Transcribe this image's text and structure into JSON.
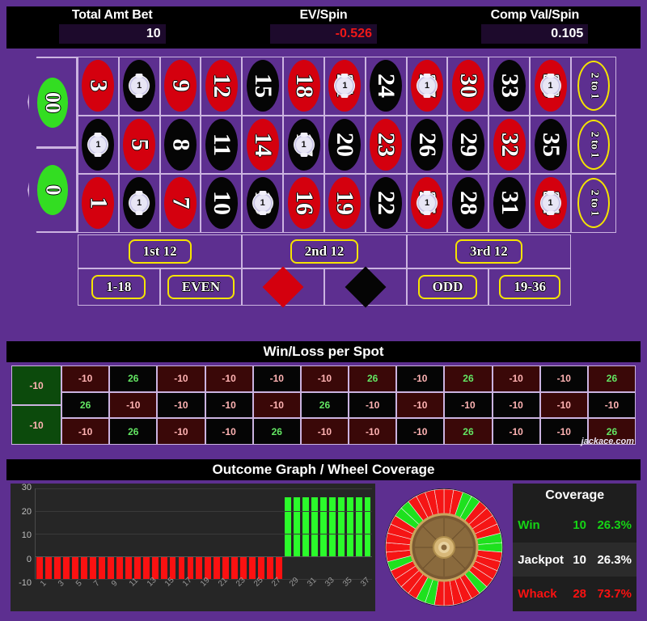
{
  "stats": [
    {
      "label": "Total Amt Bet",
      "value": "10",
      "negative": false
    },
    {
      "label": "EV/Spin",
      "value": "-0.526",
      "negative": true
    },
    {
      "label": "Comp Val/Spin",
      "value": "0.105",
      "negative": false
    }
  ],
  "table": {
    "zeros": [
      {
        "label": "00",
        "color": "green",
        "chip": null
      },
      {
        "label": "0",
        "color": "green",
        "chip": null
      }
    ],
    "rows": [
      [
        {
          "n": "3",
          "color": "red",
          "chip": null
        },
        {
          "n": "6",
          "color": "black",
          "chip": "1"
        },
        {
          "n": "9",
          "color": "red",
          "chip": null
        },
        {
          "n": "12",
          "color": "red",
          "chip": null
        },
        {
          "n": "15",
          "color": "black",
          "chip": null
        },
        {
          "n": "18",
          "color": "red",
          "chip": null
        },
        {
          "n": "21",
          "color": "red",
          "chip": "1"
        },
        {
          "n": "24",
          "color": "black",
          "chip": null
        },
        {
          "n": "27",
          "color": "red",
          "chip": "1"
        },
        {
          "n": "30",
          "color": "red",
          "chip": null
        },
        {
          "n": "33",
          "color": "black",
          "chip": null
        },
        {
          "n": "36",
          "color": "red",
          "chip": "1"
        }
      ],
      [
        {
          "n": "2",
          "color": "black",
          "chip": "1"
        },
        {
          "n": "5",
          "color": "red",
          "chip": null
        },
        {
          "n": "8",
          "color": "black",
          "chip": null
        },
        {
          "n": "11",
          "color": "black",
          "chip": null
        },
        {
          "n": "14",
          "color": "red",
          "chip": null
        },
        {
          "n": "17",
          "color": "black",
          "chip": "1"
        },
        {
          "n": "20",
          "color": "black",
          "chip": null
        },
        {
          "n": "23",
          "color": "red",
          "chip": null
        },
        {
          "n": "26",
          "color": "black",
          "chip": null
        },
        {
          "n": "29",
          "color": "black",
          "chip": null
        },
        {
          "n": "32",
          "color": "red",
          "chip": null
        },
        {
          "n": "35",
          "color": "black",
          "chip": null
        }
      ],
      [
        {
          "n": "1",
          "color": "red",
          "chip": null
        },
        {
          "n": "4",
          "color": "black",
          "chip": "1"
        },
        {
          "n": "7",
          "color": "red",
          "chip": null
        },
        {
          "n": "10",
          "color": "black",
          "chip": null
        },
        {
          "n": "13",
          "color": "black",
          "chip": "1"
        },
        {
          "n": "16",
          "color": "red",
          "chip": null
        },
        {
          "n": "19",
          "color": "red",
          "chip": null
        },
        {
          "n": "22",
          "color": "black",
          "chip": null
        },
        {
          "n": "25",
          "color": "red",
          "chip": "1"
        },
        {
          "n": "28",
          "color": "black",
          "chip": null
        },
        {
          "n": "31",
          "color": "black",
          "chip": null
        },
        {
          "n": "34",
          "color": "red",
          "chip": "1"
        }
      ]
    ],
    "column_bets": [
      "2 to 1",
      "2 to 1",
      "2 to 1"
    ],
    "dozens": [
      "1st 12",
      "2nd 12",
      "3rd 12"
    ],
    "outside": [
      {
        "type": "text",
        "label": "1-18"
      },
      {
        "type": "text",
        "label": "EVEN"
      },
      {
        "type": "diamond",
        "color": "red",
        "label": "RED"
      },
      {
        "type": "diamond",
        "color": "black",
        "label": "BLACK"
      },
      {
        "type": "text",
        "label": "ODD"
      },
      {
        "type": "text",
        "label": "19-36"
      }
    ]
  },
  "winloss": {
    "title": "Win/Loss per Spot",
    "zeros": [
      "-10",
      "-10"
    ],
    "rows": [
      [
        {
          "v": "-10",
          "cell": "red",
          "res": "lose"
        },
        {
          "v": "26",
          "cell": "black",
          "res": "win"
        },
        {
          "v": "-10",
          "cell": "red",
          "res": "lose"
        },
        {
          "v": "-10",
          "cell": "red",
          "res": "lose"
        },
        {
          "v": "-10",
          "cell": "black",
          "res": "lose"
        },
        {
          "v": "-10",
          "cell": "red",
          "res": "lose"
        },
        {
          "v": "26",
          "cell": "red",
          "res": "win"
        },
        {
          "v": "-10",
          "cell": "black",
          "res": "lose"
        },
        {
          "v": "26",
          "cell": "red",
          "res": "win"
        },
        {
          "v": "-10",
          "cell": "red",
          "res": "lose"
        },
        {
          "v": "-10",
          "cell": "black",
          "res": "lose"
        },
        {
          "v": "26",
          "cell": "red",
          "res": "win"
        }
      ],
      [
        {
          "v": "26",
          "cell": "black",
          "res": "win"
        },
        {
          "v": "-10",
          "cell": "red",
          "res": "lose"
        },
        {
          "v": "-10",
          "cell": "black",
          "res": "lose"
        },
        {
          "v": "-10",
          "cell": "black",
          "res": "lose"
        },
        {
          "v": "-10",
          "cell": "red",
          "res": "lose"
        },
        {
          "v": "26",
          "cell": "black",
          "res": "win"
        },
        {
          "v": "-10",
          "cell": "black",
          "res": "lose"
        },
        {
          "v": "-10",
          "cell": "red",
          "res": "lose"
        },
        {
          "v": "-10",
          "cell": "black",
          "res": "lose"
        },
        {
          "v": "-10",
          "cell": "black",
          "res": "lose"
        },
        {
          "v": "-10",
          "cell": "red",
          "res": "lose"
        },
        {
          "v": "-10",
          "cell": "black",
          "res": "lose"
        }
      ],
      [
        {
          "v": "-10",
          "cell": "red",
          "res": "lose"
        },
        {
          "v": "26",
          "cell": "black",
          "res": "win"
        },
        {
          "v": "-10",
          "cell": "red",
          "res": "lose"
        },
        {
          "v": "-10",
          "cell": "black",
          "res": "lose"
        },
        {
          "v": "26",
          "cell": "black",
          "res": "win"
        },
        {
          "v": "-10",
          "cell": "red",
          "res": "lose"
        },
        {
          "v": "-10",
          "cell": "red",
          "res": "lose"
        },
        {
          "v": "-10",
          "cell": "black",
          "res": "lose"
        },
        {
          "v": "26",
          "cell": "red",
          "res": "win"
        },
        {
          "v": "-10",
          "cell": "black",
          "res": "lose"
        },
        {
          "v": "-10",
          "cell": "black",
          "res": "lose"
        },
        {
          "v": "26",
          "cell": "red",
          "res": "win"
        }
      ]
    ],
    "watermark": "jackace.com"
  },
  "graph_panel": {
    "title": "Outcome Graph / Wheel Coverage"
  },
  "chart_data": {
    "type": "bar",
    "title": "Outcome Graph / Wheel Coverage",
    "xlabel": "",
    "ylabel": "",
    "ylim": [
      -10,
      30
    ],
    "yticks": [
      30,
      20,
      10,
      0,
      -10
    ],
    "grid": true,
    "x": [
      1,
      2,
      3,
      4,
      5,
      6,
      7,
      8,
      9,
      10,
      11,
      12,
      13,
      14,
      15,
      16,
      17,
      18,
      19,
      20,
      21,
      22,
      23,
      24,
      25,
      26,
      27,
      28,
      29,
      30,
      31,
      32,
      33,
      34,
      35,
      36,
      37,
      38
    ],
    "xtick_labels": [
      "1",
      "3",
      "5",
      "7",
      "9",
      "11",
      "13",
      "15",
      "17",
      "19",
      "21",
      "23",
      "25",
      "27",
      "29",
      "31",
      "33",
      "35",
      "37"
    ],
    "values": [
      -10,
      -10,
      -10,
      -10,
      -10,
      -10,
      -10,
      -10,
      -10,
      -10,
      -10,
      -10,
      -10,
      -10,
      -10,
      -10,
      -10,
      -10,
      -10,
      -10,
      -10,
      -10,
      -10,
      -10,
      -10,
      -10,
      -10,
      -10,
      26,
      26,
      26,
      26,
      26,
      26,
      26,
      26,
      26,
      26
    ],
    "bar_colors": [
      "#fb1111",
      "#fb1111",
      "#fb1111",
      "#fb1111",
      "#fb1111",
      "#fb1111",
      "#fb1111",
      "#fb1111",
      "#fb1111",
      "#fb1111",
      "#fb1111",
      "#fb1111",
      "#fb1111",
      "#fb1111",
      "#fb1111",
      "#fb1111",
      "#fb1111",
      "#fb1111",
      "#fb1111",
      "#fb1111",
      "#fb1111",
      "#fb1111",
      "#fb1111",
      "#fb1111",
      "#fb1111",
      "#fb1111",
      "#fb1111",
      "#fb1111",
      "#2bfb2b",
      "#2bfb2b",
      "#2bfb2b",
      "#2bfb2b",
      "#2bfb2b",
      "#2bfb2b",
      "#2bfb2b",
      "#2bfb2b",
      "#2bfb2b",
      "#2bfb2b"
    ]
  },
  "wheel": {
    "segments": 38,
    "win_color": "#1ee11e",
    "whack_color": "#f51515",
    "win_indices": [
      2,
      3,
      8,
      9,
      14,
      20,
      21,
      26,
      32,
      33
    ]
  },
  "coverage": {
    "title": "Coverage",
    "rows": [
      {
        "name": "Win",
        "count": "10",
        "pct": "26.3%",
        "style": "cv-win"
      },
      {
        "name": "Jackpot",
        "count": "10",
        "pct": "26.3%",
        "style": "cv-jack"
      },
      {
        "name": "Whack",
        "count": "28",
        "pct": "73.7%",
        "style": "cv-whack"
      }
    ]
  }
}
